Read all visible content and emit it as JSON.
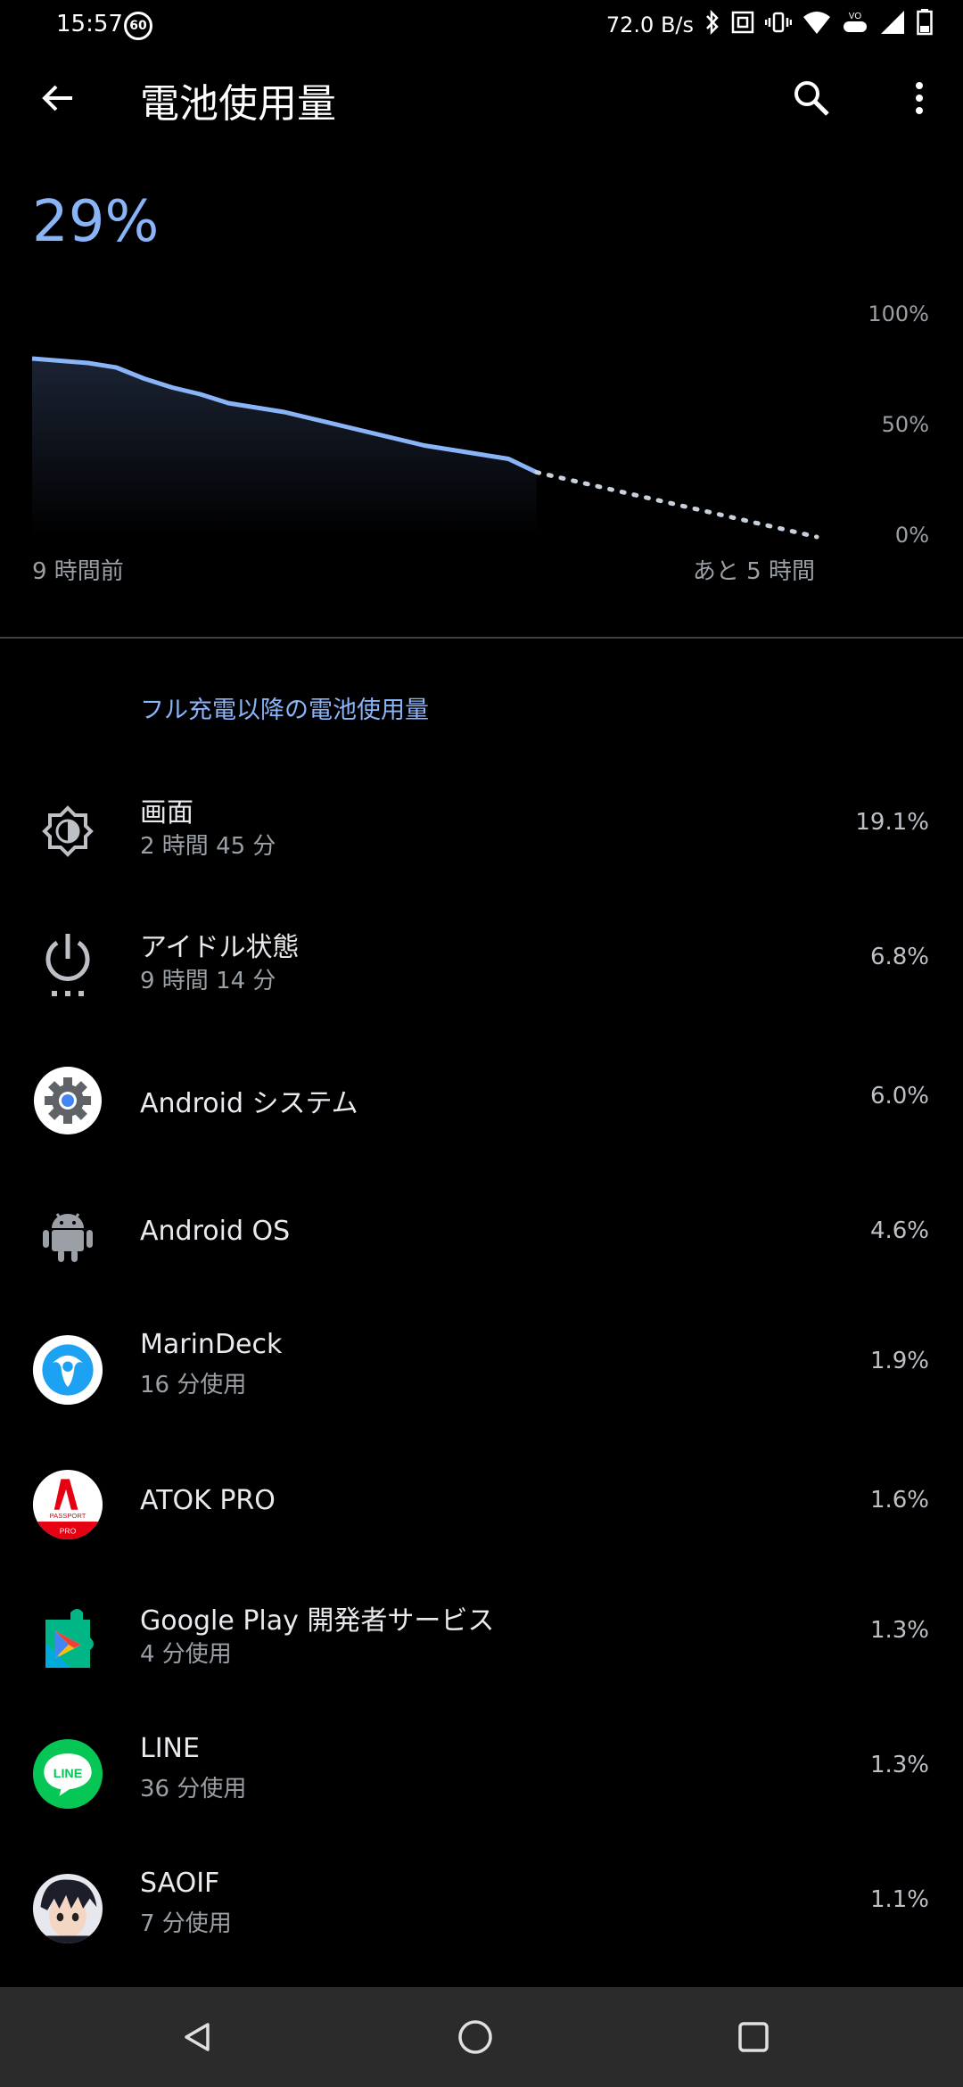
{
  "status_bar": {
    "time": "15:57",
    "badge": "60",
    "speed": "72.0 B/s"
  },
  "appbar": {
    "title": "電池使用量"
  },
  "battery": {
    "percent": "29%"
  },
  "chart_data": {
    "type": "area",
    "y_tick_labels": [
      "100%",
      "50%",
      "0%"
    ],
    "x_start_label": "9 時間前",
    "x_end_label": "あと 5 時間",
    "ylim": [
      0,
      100
    ],
    "x": [
      0,
      0.5,
      1,
      1.5,
      2,
      2.5,
      3,
      3.5,
      4,
      4.5,
      5,
      5.5,
      6,
      6.5,
      7,
      7.5,
      8,
      8.5,
      9
    ],
    "values": [
      80,
      79,
      78,
      76,
      71,
      67,
      64,
      60,
      58,
      56,
      53,
      50,
      47,
      44,
      41,
      39,
      37,
      35,
      29
    ],
    "prediction_x": [
      9,
      14
    ],
    "prediction_values": [
      29,
      0
    ]
  },
  "section": {
    "title": "フル充電以降の電池使用量"
  },
  "items": [
    {
      "name": "画面",
      "sub": "2 時間 45 分",
      "pct": "19.1%",
      "icon": "brightness-icon"
    },
    {
      "name": "アイドル状態",
      "sub": "9 時間 14 分",
      "pct": "6.8%",
      "icon": "power-idle-icon"
    },
    {
      "name": "Android システム",
      "sub": "",
      "pct": "6.0%",
      "icon": "android-settings-icon"
    },
    {
      "name": "Android OS",
      "sub": "",
      "pct": "4.6%",
      "icon": "android-robot-icon"
    },
    {
      "name": "MarinDeck",
      "sub": "16 分使用",
      "pct": "1.9%",
      "icon": "marindeck-icon"
    },
    {
      "name": "ATOK PRO",
      "sub": "",
      "pct": "1.6%",
      "icon": "atok-icon",
      "icon_text_a": "PASSPORT",
      "icon_text_b": "PRO"
    },
    {
      "name": "Google Play 開発者サービス",
      "sub": "4 分使用",
      "pct": "1.3%",
      "icon": "google-play-services-icon"
    },
    {
      "name": "LINE",
      "sub": "36 分使用",
      "pct": "1.3%",
      "icon": "line-icon",
      "icon_text": "LINE"
    },
    {
      "name": "SAOIF",
      "sub": "7 分使用",
      "pct": "1.1%",
      "icon": "saoif-avatar-icon"
    }
  ],
  "colors": {
    "accent": "#8AB4F8",
    "background": "#000000",
    "navbar": "#2b2b2b"
  }
}
